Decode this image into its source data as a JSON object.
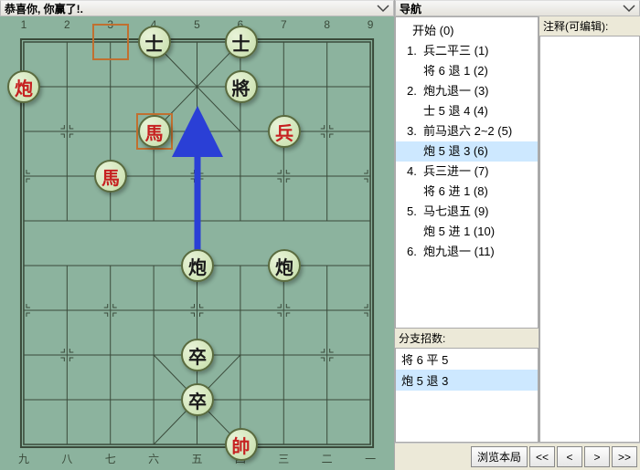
{
  "left": {
    "title": "恭喜你, 你赢了!.",
    "files_top": [
      "1",
      "2",
      "3",
      "4",
      "5",
      "6",
      "7",
      "8",
      "9"
    ],
    "files_bottom": [
      "九",
      "八",
      "七",
      "六",
      "五",
      "四",
      "三",
      "二",
      "一"
    ]
  },
  "board": {
    "highlights": [
      {
        "col": 3,
        "row": 1
      },
      {
        "col": 4,
        "row": 3
      }
    ],
    "arrow": {
      "from": {
        "col": 5,
        "row": 6
      },
      "to": {
        "col": 5,
        "row": 3
      }
    },
    "pieces": [
      {
        "char": "士",
        "side": "black",
        "col": 4,
        "row": 1
      },
      {
        "char": "士",
        "side": "black",
        "col": 6,
        "row": 1
      },
      {
        "char": "將",
        "side": "black",
        "col": 6,
        "row": 2
      },
      {
        "char": "炮",
        "side": "red",
        "col": 1,
        "row": 2
      },
      {
        "char": "馬",
        "side": "red",
        "col": 4,
        "row": 3
      },
      {
        "char": "兵",
        "side": "red",
        "col": 7,
        "row": 3
      },
      {
        "char": "馬",
        "side": "red",
        "col": 3,
        "row": 4
      },
      {
        "char": "炮",
        "side": "black",
        "col": 5,
        "row": 6
      },
      {
        "char": "炮",
        "side": "black",
        "col": 7,
        "row": 6
      },
      {
        "char": "卒",
        "side": "black",
        "col": 5,
        "row": 8
      },
      {
        "char": "卒",
        "side": "black",
        "col": 5,
        "row": 9
      },
      {
        "char": "帥",
        "side": "red",
        "col": 6,
        "row": 10
      }
    ]
  },
  "nav": {
    "title": "导航",
    "items": [
      {
        "num": "",
        "text": "开始 (0)",
        "root": true
      },
      {
        "num": "1",
        "text": "兵二平三 (1)"
      },
      {
        "num": "",
        "text": "将 6 退 1  (2)"
      },
      {
        "num": "2",
        "text": "炮九退一 (3)"
      },
      {
        "num": "",
        "text": "士 5 退 4  (4)"
      },
      {
        "num": "3",
        "text": "前马退六 2~2  (5)"
      },
      {
        "num": "",
        "text": "炮 5 退 3  (6)",
        "selected": true
      },
      {
        "num": "4",
        "text": "兵三进一 (7)"
      },
      {
        "num": "",
        "text": "将 6 进 1  (8)"
      },
      {
        "num": "5",
        "text": "马七退五 (9)"
      },
      {
        "num": "",
        "text": "炮 5 进 1  (10)"
      },
      {
        "num": "6",
        "text": "炮九退一 (11)"
      }
    ],
    "branch_label": "分支招数:",
    "branches": [
      {
        "text": "将 6 平 5"
      },
      {
        "text": "炮 5 退 3",
        "selected": true
      }
    ]
  },
  "comment": {
    "title": "注释(可编辑):"
  },
  "buttons": {
    "browse": "浏览本局",
    "first": "<<",
    "prev": "<",
    "next": ">",
    "last": ">>"
  }
}
